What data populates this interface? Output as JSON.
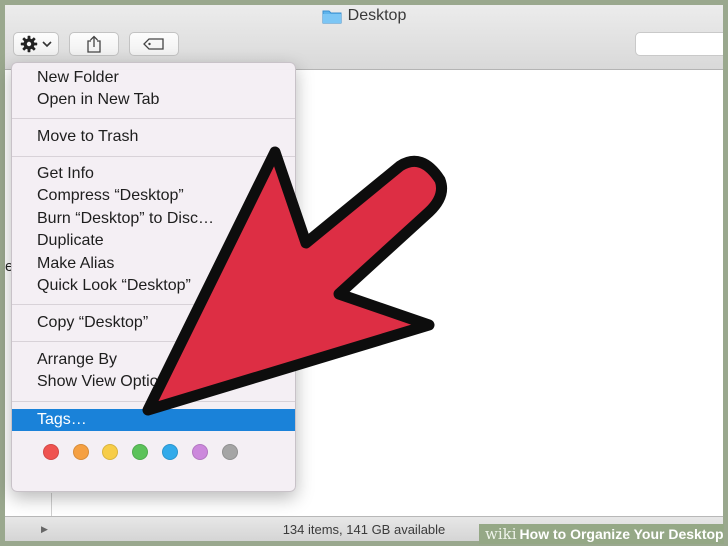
{
  "window": {
    "title": "Desktop",
    "status": "134 items, 141 GB available",
    "partial_left_text": "e"
  },
  "toolbar": {
    "action_icon": "gear-icon",
    "share_icon": "share-icon",
    "tag_icon": "tag-icon"
  },
  "menu": {
    "items": [
      {
        "label": "New Folder"
      },
      {
        "label": "Open in New Tab"
      },
      {
        "label": "Move to Trash"
      },
      {
        "label": "Get Info"
      },
      {
        "label": "Compress “Desktop”"
      },
      {
        "label": "Burn “Desktop” to Disc…"
      },
      {
        "label": "Duplicate"
      },
      {
        "label": "Make Alias"
      },
      {
        "label": "Quick Look “Desktop”"
      },
      {
        "label": "Copy “Desktop”"
      },
      {
        "label": "Arrange By"
      },
      {
        "label": "Show View Options"
      },
      {
        "label": "Tags…",
        "selected": true
      }
    ],
    "tag_colors": [
      "#ef5350",
      "#f5a042",
      "#f7cd48",
      "#5cc25a",
      "#32aaea",
      "#cc88dc",
      "#a5a5a5"
    ],
    "selected_color": "#1a82d9"
  },
  "overlay": {
    "arrow_color": "#dd2e44"
  },
  "watermark": {
    "wiki": "wiki",
    "text": "How to Organize Your Desktop"
  }
}
